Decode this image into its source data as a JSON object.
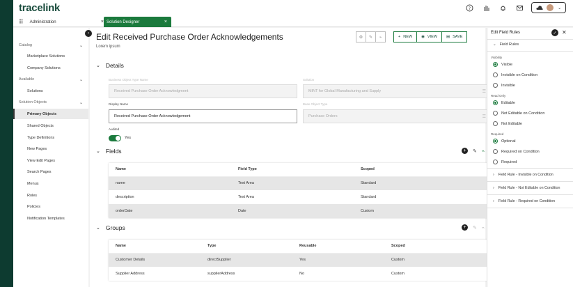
{
  "app": {
    "logo": "tracelink"
  },
  "tabs": [
    {
      "label": "Administration",
      "close": "×"
    },
    {
      "label": "Solution Designer",
      "close": "×"
    }
  ],
  "sidebar": {
    "sections": [
      {
        "label": "Catalog",
        "items": [
          "Marketplace Solutions",
          "Company Solutions"
        ]
      },
      {
        "label": "Available",
        "items": [
          "Solutions"
        ]
      },
      {
        "label": "Solution Objects",
        "items": [
          "Primary Objects",
          "Shared Objects",
          "Type Definitions",
          "New Pages",
          "View Edit Pages",
          "Search Pages",
          "Menus",
          "Roles",
          "Policies",
          "Notification Templates"
        ]
      }
    ],
    "active_item": "Primary Objects"
  },
  "main": {
    "title": "Edit Received Purchase Order Acknowledgements",
    "subtitle": "Lorem ipsum",
    "actions": {
      "new": "NEW",
      "view": "VIEW",
      "save": "SAVE"
    },
    "details": {
      "heading": "Details",
      "business_object_type_name_label": "Business Object Type Name",
      "business_object_type_name_value": "Received Purchase Order Acknowledgment",
      "solution_label": "Solution",
      "solution_value": "MINT for Global Manufacturing and Supply",
      "display_name_label": "Display Name",
      "display_name_value": "Received Purchase Order Acknowledgement",
      "base_object_type_label": "Base Object Type",
      "base_object_type_value": "Purchase Orders",
      "audited_label": "Audited",
      "audited_value": "Yes"
    },
    "fields": {
      "heading": "Fields",
      "columns": [
        "Name",
        "Field Type",
        "Scoped"
      ],
      "rows": [
        [
          "name",
          "Text Area",
          "Standard"
        ],
        [
          "description",
          "Text Area",
          "Standard"
        ],
        [
          "orderDate",
          "Date",
          "Custom"
        ]
      ]
    },
    "groups": {
      "heading": "Groups",
      "columns": [
        "Name",
        "Type",
        "Reusable",
        "Scoped"
      ],
      "rows": [
        [
          "Customer Details",
          "directSupplier",
          "Yes",
          "Custom"
        ],
        [
          "Supplier Address",
          "supplierAddress",
          "No",
          "Custom"
        ]
      ]
    }
  },
  "panel": {
    "title": "Edit Field Rules",
    "section": "Field Rules",
    "visibility": {
      "label": "Visibility",
      "options": [
        "Visible",
        "Invisible on Condition",
        "Invisible"
      ],
      "selected": "Visible"
    },
    "read_only": {
      "label": "Read Only",
      "options": [
        "Editable",
        "Not Editable on Condition",
        "Not Editable"
      ],
      "selected": "Editable"
    },
    "required": {
      "label": "Required",
      "options": [
        "Optional",
        "Required on Condition",
        "Required"
      ],
      "selected": "Optional"
    },
    "rules": [
      "Field Rule - Invisible on Condition",
      "Field Rule - Not Editable on Condition",
      "Field Rule - Required on Condition"
    ]
  },
  "colors": {
    "brand": "#1b7a3d",
    "logo": "#1b4d3e",
    "background": "#0d3b30"
  }
}
